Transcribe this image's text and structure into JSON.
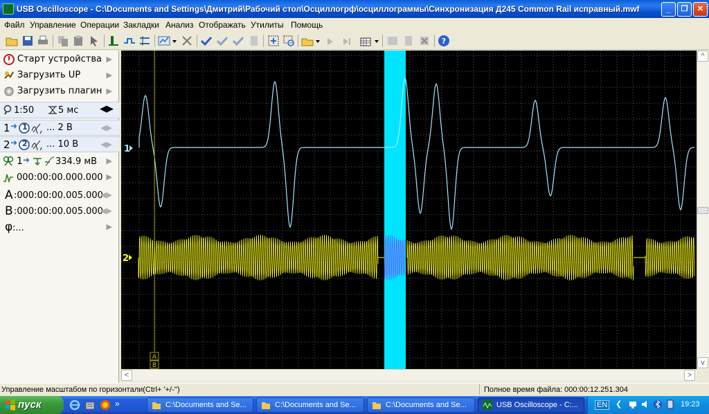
{
  "window": {
    "title": "USB Oscilloscope - C:\\Documents and Settings\\Дмитрий\\Рабочий стол\\Осциллогрф\\осциллограммы\\Синхронизация Д245 Common Rail исправный.mwf",
    "minimize": "_",
    "restore": "❐",
    "close": "✕"
  },
  "menu": {
    "items": [
      "Файл",
      "Управление",
      "Операции",
      "Закладки",
      "Анализ",
      "Отображать",
      "Утилиты",
      "Помощь"
    ]
  },
  "toolbar": {
    "icons": [
      "open-icon",
      "save-icon",
      "print-icon",
      "copy-icon",
      "paste-icon",
      "cursor-icon",
      "trigger-icon",
      "measure-icon",
      "channels-icon",
      "display-icon",
      "cut-icon",
      "check-icon",
      "check-all-icon",
      "check-down-icon",
      "page-icon",
      "zoom-fit-icon",
      "zoom-area-icon",
      "open-ref-icon",
      "play-icon",
      "step-icon",
      "grid-icon",
      "capture-icon",
      "document-icon",
      "delete-icon",
      "help-icon"
    ]
  },
  "left_panel": {
    "start_device": "Старт устройства",
    "load_up": "Загрузить UP",
    "load_plugin": "Загрузить плагин",
    "zoom": "1:50",
    "timebase": "5 мс",
    "ch1_num": "1",
    "ch1_index": "1",
    "ch1_scale": "... 2 В",
    "ch2_num": "2",
    "ch2_index": "2",
    "ch2_scale": "... 10 В",
    "trigger_channel": "1",
    "trigger_level": "334.9 мВ",
    "trigger_time": "000:00:00.000.000",
    "cursor_a_label": "A",
    "cursor_a": ":000:00:00.005.000",
    "cursor_b_label": "B",
    "cursor_b": ":000:00:00.005.000",
    "phi_label": "φ",
    "phi_value": ":..."
  },
  "scope": {
    "ch1_marker": "1",
    "ch2_marker": "2",
    "cursor_a_mark": "A",
    "cursor_b_mark": "B",
    "colors": {
      "background": "#000000",
      "grid": "#5a5a5a",
      "ch1": "#a8e4ff",
      "ch2": "#ffff1e",
      "highlight": "#00e5ff",
      "cursor": "#9b9b00"
    }
  },
  "scrollbars": {
    "left": "<",
    "right": ">",
    "up": "^",
    "down": "v"
  },
  "status": {
    "hint": "Управление масштабом по горизонтали(Ctrl+ '+/-'')",
    "total_time": "Полное время файла: 000:00:12.251.304"
  },
  "taskbar": {
    "start": "пуск",
    "tasks": [
      "C:\\Documents and Se...",
      "C:\\Documents and Se...",
      "C:\\Documents and Se...",
      "USB Oscilloscope - C:..."
    ],
    "lang": "EN",
    "clock": "19:23"
  }
}
